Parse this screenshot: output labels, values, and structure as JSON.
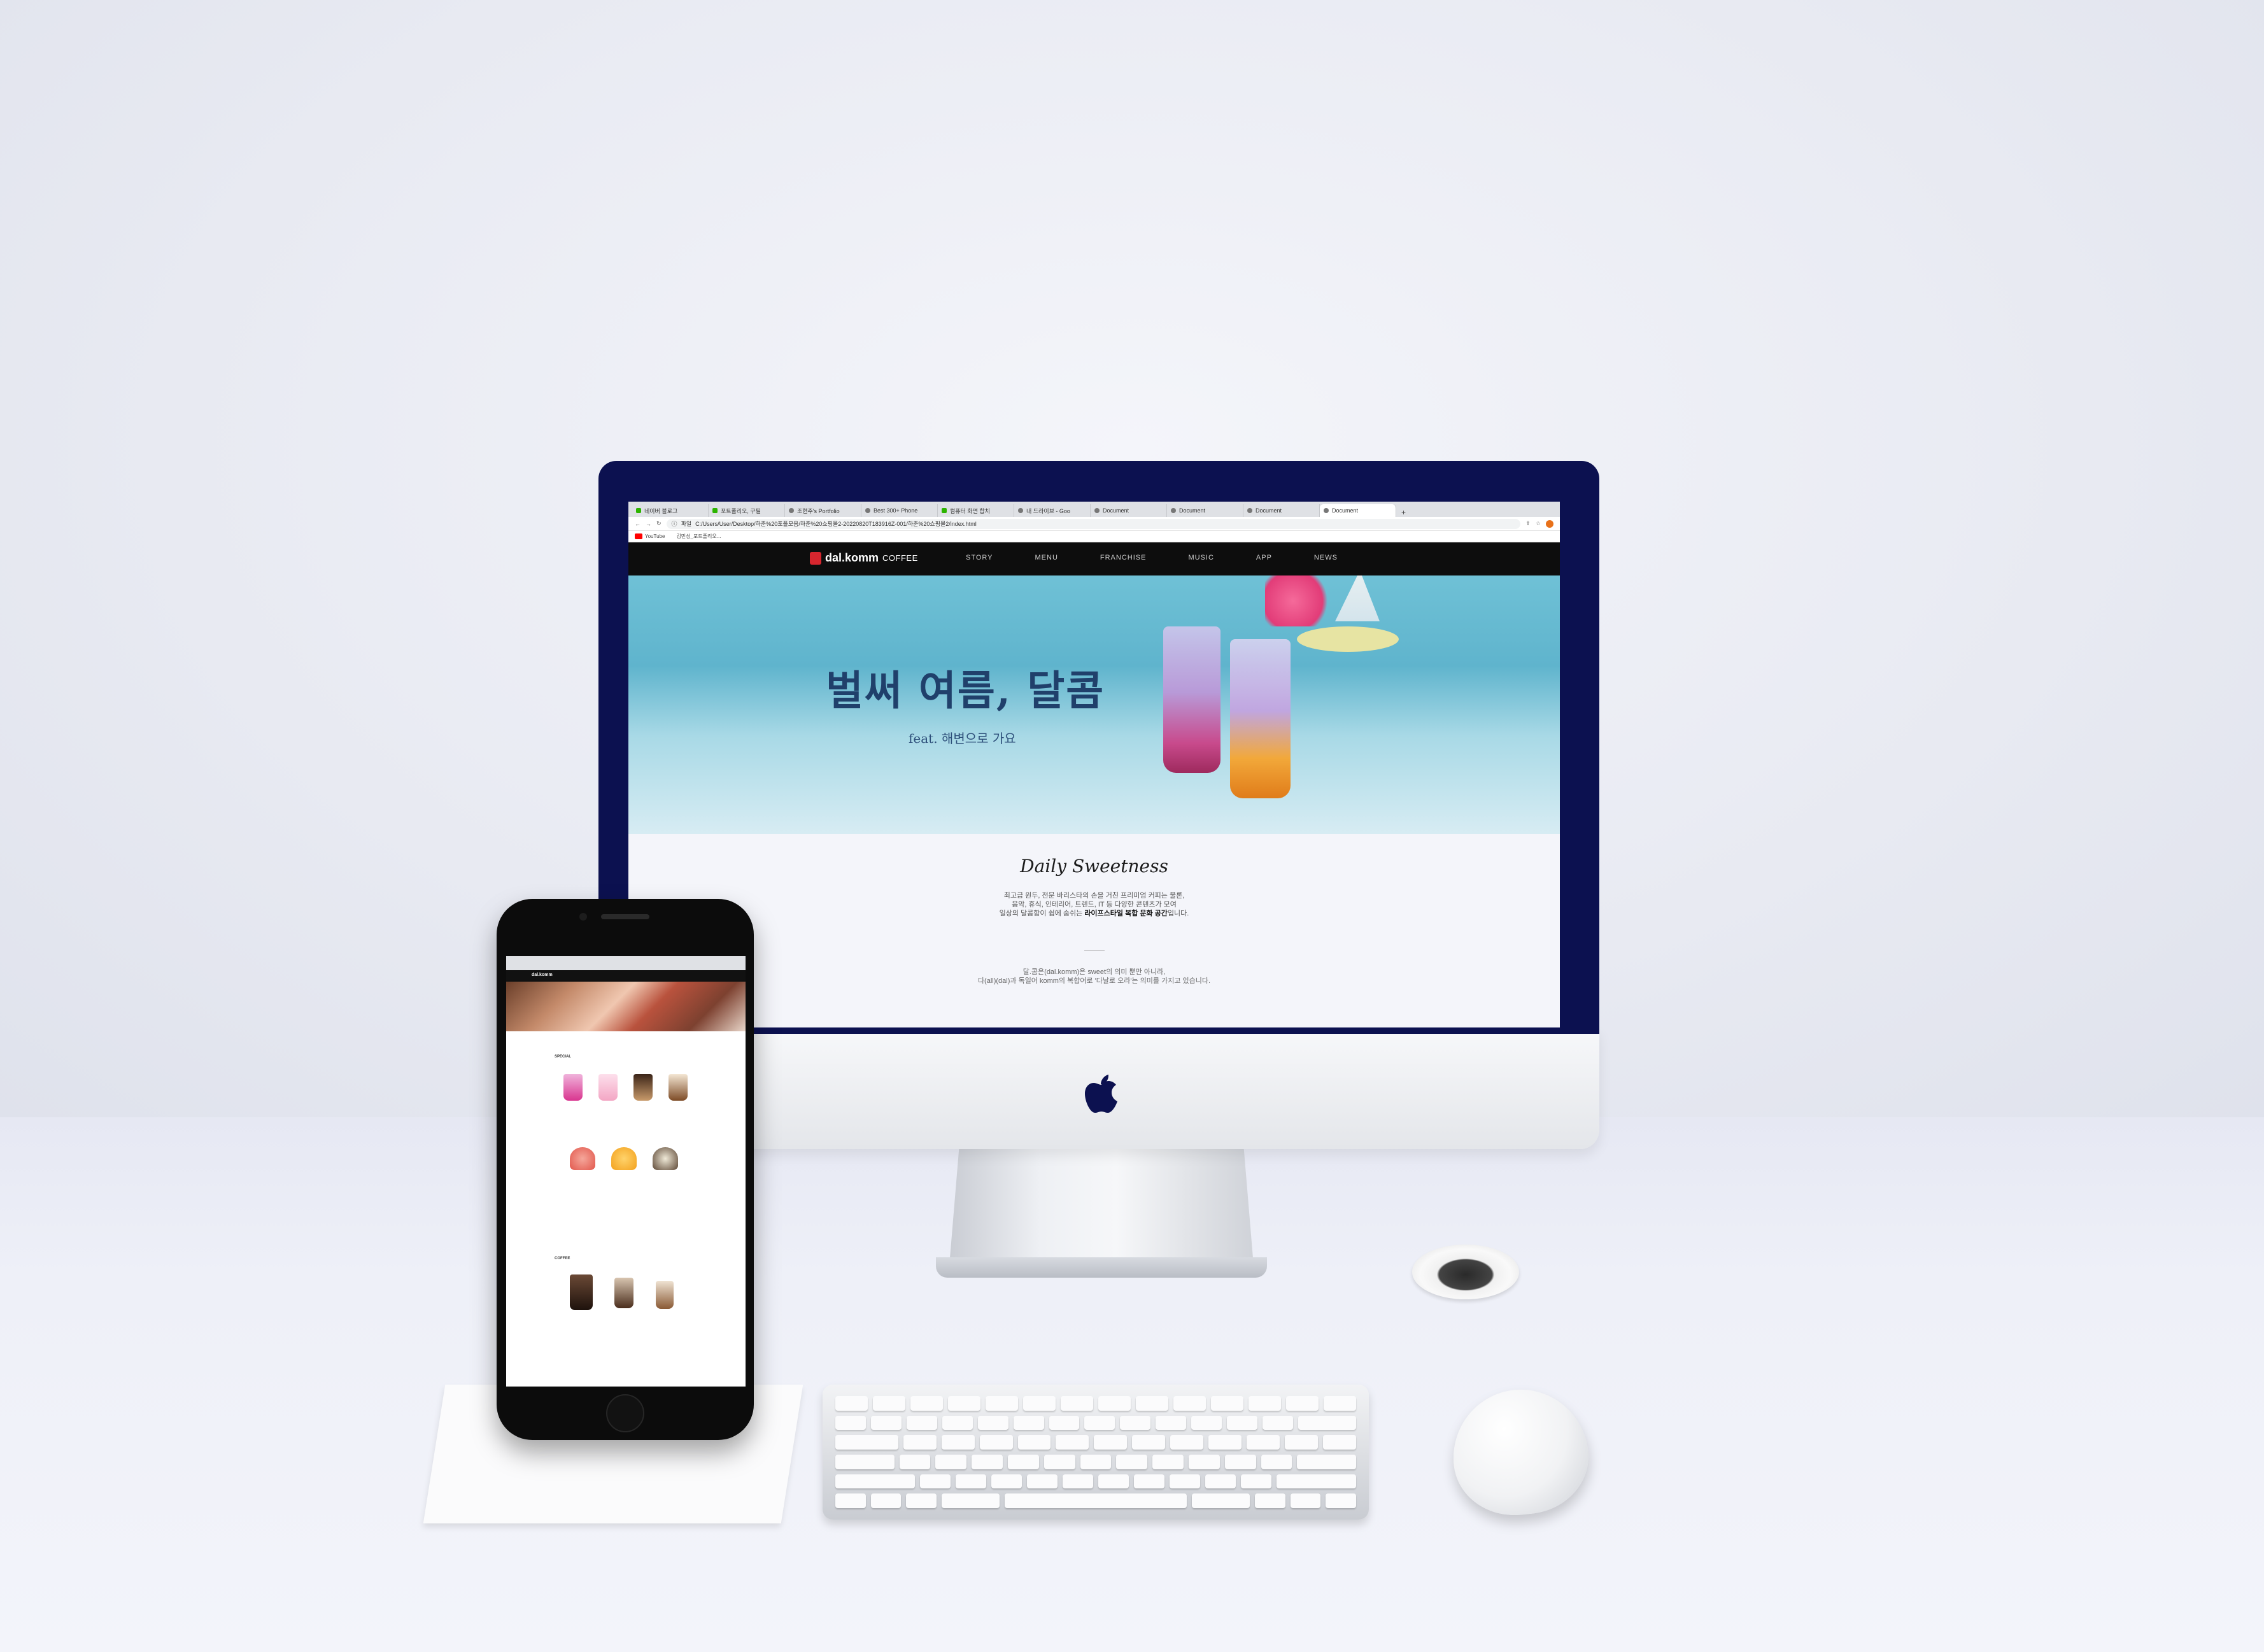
{
  "browser": {
    "tabs": [
      {
        "label": "네이버 블로그",
        "icon": "naver"
      },
      {
        "label": "포트폴리오, 구필",
        "icon": "naver"
      },
      {
        "label": "조현주's Portfolio",
        "icon": "globe"
      },
      {
        "label": "Best 300+ Phone",
        "icon": "user"
      },
      {
        "label": "컴퓨터 화면 합치",
        "icon": "naver"
      },
      {
        "label": "내 드라이브 - Goo",
        "icon": "drive"
      },
      {
        "label": "Document",
        "icon": "globe"
      },
      {
        "label": "Document",
        "icon": "globe"
      },
      {
        "label": "Document",
        "icon": "globe"
      },
      {
        "label": "Document",
        "icon": "globe"
      }
    ],
    "url_prefix": "파일",
    "url": "C:/Users/User/Desktop/하준%20포폴모음/하준%20쇼핑몰2-20220820T183916Z-001/하준%20쇼핑몰2/index.html",
    "bookmarks": [
      "YouTube",
      "김민성_포트폴리오..."
    ]
  },
  "site": {
    "logo_main": "dal.komm",
    "logo_sub": "COFFEE",
    "nav": [
      "STORY",
      "MENU",
      "FRANCHISE",
      "MUSIC",
      "APP",
      "NEWS"
    ],
    "hero_title": "벌써 여름, 달콤",
    "hero_sub": "feat. 해변으로 가요",
    "about_title": "Daily Sweetness",
    "about_line1": "최고급 원두, 전문 바리스타의 손을 거친 프리미엄 커피는 물론,",
    "about_line2": "음악, 휴식, 인테리어, 트렌드, IT 등 다양한 콘텐츠가 모여",
    "about_line3_pre": "일상의 달콤함이 쉼에 숨쉬는 ",
    "about_line3_bold": "라이프스타일 복합 문화 공간",
    "about_line3_post": "입니다.",
    "about_text2_line1": "달.콤은(dal.komm)은 sweet의 의미 뿐만 아니라,",
    "about_text2_line2": "다(all)(dal)과 독일어 komm의 복합어로 '다날로 오라'는 의미를 가지고 있습니다."
  },
  "phone_site": {
    "logo": "dal.komm",
    "section_special": "SPECIAL",
    "section_coffee": "COFFEE"
  },
  "colors": {
    "bezel": "#0c1150",
    "nav_bg": "#0d0d0d",
    "hero_title": "#20406b",
    "logo_red": "#d7262e"
  }
}
